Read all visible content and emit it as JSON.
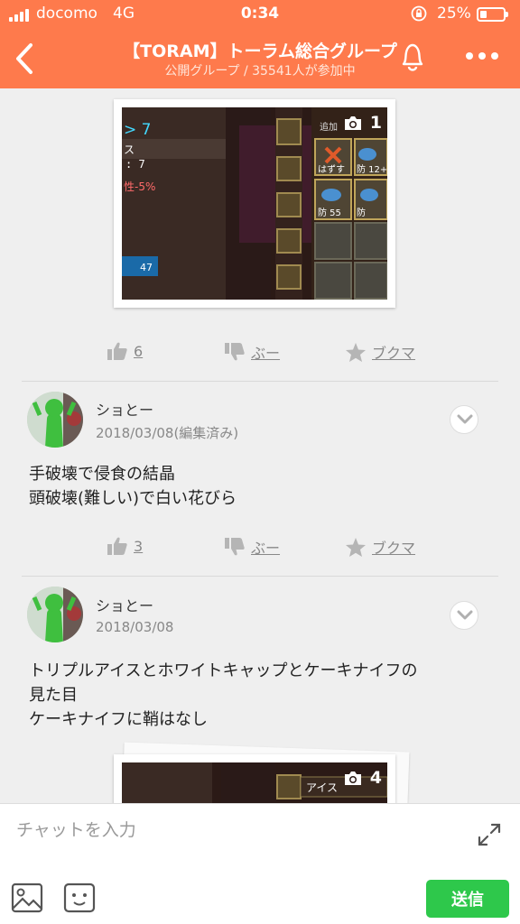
{
  "status_bar": {
    "carrier": "docomo",
    "network": "4G",
    "time": "0:34",
    "battery_percent": "25%",
    "battery_level": 0.25
  },
  "header": {
    "title": "【TORAM】トーラム総合グループ",
    "subtitle": "公開グループ / 35541人が参加中",
    "icons": [
      "chevron-left-icon",
      "bell-icon",
      "more-dots-icon"
    ]
  },
  "posts": [
    {
      "photo_count": "1",
      "game_text": {
        "level": "> 7",
        "stat_line": "ス",
        "stat_value": ": 7",
        "element": "性-5%",
        "gold": "47",
        "slot_remove": "はずす",
        "def_a": "防 12+",
        "def_b": "防   55",
        "def_c": "防",
        "tab_header": "追加"
      },
      "actions": {
        "like_count": "6",
        "dislike_label": "ぶー",
        "bookmark_label": "ブクマ"
      }
    },
    {
      "user": "ショとー",
      "date": "2018/03/08(編集済み)",
      "text_lines": [
        "手破壊で侵食の結晶",
        "頭破壊(難しい)で白い花びら"
      ],
      "actions": {
        "like_count": "3",
        "dislike_label": "ぶー",
        "bookmark_label": "ブクマ"
      }
    },
    {
      "user": "ショとー",
      "date": "2018/03/08",
      "text_lines": [
        "トリプルアイスとホワイトキャップとケーキナイフの",
        "見た目",
        "ケーキナイフに鞘はなし"
      ],
      "photo_count": "4",
      "game_text": {
        "item_label": "アイス"
      }
    }
  ],
  "composer": {
    "placeholder": "チャットを入力",
    "send_label": "送信",
    "send_color": "#2ec84b"
  },
  "colors": {
    "accent": "#fe7a4c",
    "background": "#efefef"
  }
}
